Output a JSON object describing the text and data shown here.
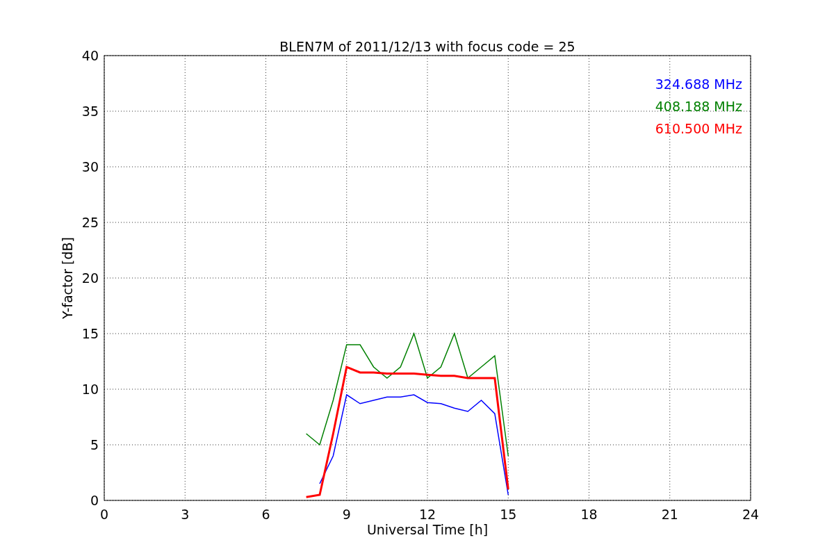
{
  "chart_data": {
    "type": "line",
    "title": "BLEN7M of 2011/12/13 with focus code = 25",
    "xlabel": "Universal Time [h]",
    "ylabel": "Y-factor [dB]",
    "x": [
      7.5,
      8,
      8.5,
      9,
      9.5,
      10,
      10.5,
      11,
      11.5,
      12,
      12.5,
      13,
      13.5,
      14,
      14.5,
      15
    ],
    "series": [
      {
        "name": "324.688 MHz",
        "color": "#0000ff",
        "values": [
          null,
          1.5,
          4,
          9.5,
          8.7,
          9,
          9.3,
          9.3,
          9.5,
          8.8,
          8.7,
          8.3,
          8.0,
          9.0,
          7.8,
          0.5
        ]
      },
      {
        "name": "408.188 MHz",
        "color": "#008000",
        "values": [
          6,
          5,
          9,
          14,
          14,
          12,
          11,
          12,
          15,
          11,
          12,
          15,
          11,
          12,
          13,
          4
        ]
      },
      {
        "name": "610.500 MHz",
        "color": "#ff0000",
        "values": [
          0.3,
          0.5,
          6,
          12,
          11.5,
          11.5,
          11.4,
          11.4,
          11.4,
          11.3,
          11.2,
          11.2,
          11,
          11,
          11,
          1
        ]
      }
    ],
    "grid": true,
    "xlim": [
      0,
      24
    ],
    "ylim": [
      0,
      40
    ],
    "xticks": [
      0,
      3,
      6,
      9,
      12,
      15,
      18,
      21,
      24
    ],
    "yticks": [
      0,
      5,
      10,
      15,
      20,
      25,
      30,
      35,
      40
    ]
  }
}
